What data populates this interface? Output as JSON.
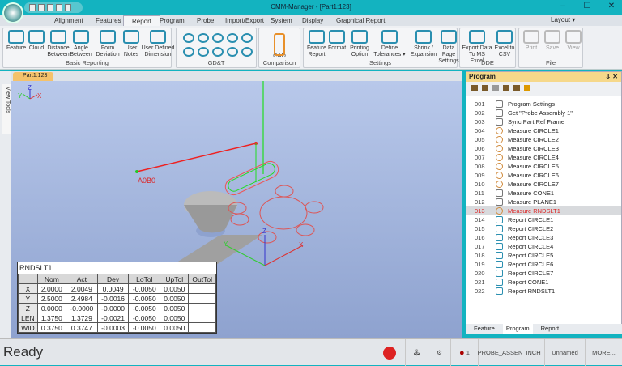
{
  "window": {
    "title": "CMM-Manager - [Part1:123]",
    "minimize": "–",
    "maximize": "☐",
    "close": "✕"
  },
  "ribbon_tabs": [
    "Alignment",
    "Features",
    "Report",
    "Program",
    "Probe",
    "Import/Export",
    "System",
    "Display",
    "Graphical Report"
  ],
  "active_tab": "Report",
  "ribbon_right": {
    "layout": "Layout ▾"
  },
  "groups": [
    {
      "label": "Basic Reporting",
      "buttons": [
        "Feature",
        "Cloud",
        "Distance Between",
        "Angle Between",
        "Form Deviation",
        "User Notes",
        "User Defined Dimension"
      ]
    },
    {
      "label": "GD&T",
      "buttons": []
    },
    {
      "label": "CAD Comparison",
      "buttons": []
    },
    {
      "label": "Settings",
      "buttons": [
        "Feature Report",
        "Format",
        "Printing Option",
        "Define Tolerances ▾",
        "Shrink / Expansion",
        "Data Page Settings"
      ]
    },
    {
      "label": "DDE",
      "buttons": [
        "Export Data To MS Excel",
        "Excel to CSV"
      ]
    },
    {
      "label": "File",
      "buttons": [
        "Print",
        "Save",
        "View"
      ]
    }
  ],
  "view_tools": "View Tools",
  "doc_tab": "Part1:123",
  "viewport": {
    "label": "A0B0",
    "axes": {
      "x": "X",
      "y": "Y",
      "z": "Z"
    }
  },
  "result_table": {
    "title": "RNDSLT1",
    "headers": [
      "",
      "Nom",
      "Act",
      "Dev",
      "LoTol",
      "UpTol",
      "OutTol"
    ],
    "rows": [
      [
        "X",
        "2.0000",
        "2.0049",
        "0.0049",
        "-0.0050",
        "0.0050",
        ""
      ],
      [
        "Y",
        "2.5000",
        "2.4984",
        "-0.0016",
        "-0.0050",
        "0.0050",
        ""
      ],
      [
        "Z",
        "0.0000",
        "-0.0000",
        "-0.0000",
        "-0.0050",
        "0.0050",
        ""
      ],
      [
        "LEN",
        "1.3750",
        "1.3729",
        "-0.0021",
        "-0.0050",
        "0.0050",
        ""
      ],
      [
        "WID",
        "0.3750",
        "0.3747",
        "-0.0003",
        "-0.0050",
        "0.0050",
        ""
      ]
    ]
  },
  "program": {
    "title": "Program",
    "selected": "013",
    "items": [
      [
        "001",
        "Program Settings"
      ],
      [
        "002",
        "Get \"Probe Assembly 1\""
      ],
      [
        "003",
        "Sync Part Ref Frame"
      ],
      [
        "004",
        "Measure CIRCLE1"
      ],
      [
        "005",
        "Measure CIRCLE2"
      ],
      [
        "006",
        "Measure CIRCLE3"
      ],
      [
        "007",
        "Measure CIRCLE4"
      ],
      [
        "008",
        "Measure CIRCLE5"
      ],
      [
        "009",
        "Measure CIRCLE6"
      ],
      [
        "010",
        "Measure CIRCLE7"
      ],
      [
        "011",
        "Measure CONE1"
      ],
      [
        "012",
        "Measure PLANE1"
      ],
      [
        "013",
        "Measure RNDSLT1"
      ],
      [
        "014",
        "Report CIRCLE1"
      ],
      [
        "015",
        "Report CIRCLE2"
      ],
      [
        "016",
        "Report CIRCLE3"
      ],
      [
        "017",
        "Report CIRCLE4"
      ],
      [
        "018",
        "Report CIRCLE5"
      ],
      [
        "019",
        "Report CIRCLE6"
      ],
      [
        "020",
        "Report CIRCLE7"
      ],
      [
        "021",
        "Report CONE1"
      ],
      [
        "022",
        "Report RNDSLT1"
      ]
    ],
    "tabs": [
      "Feature",
      "Program",
      "Report"
    ],
    "active_panel_tab": "Program"
  },
  "status": {
    "text": "Ready",
    "probe_count": "1",
    "probe": "PROBE_ASSEN",
    "units": "INCH",
    "name": "Unnamed",
    "more": "MORE..."
  }
}
